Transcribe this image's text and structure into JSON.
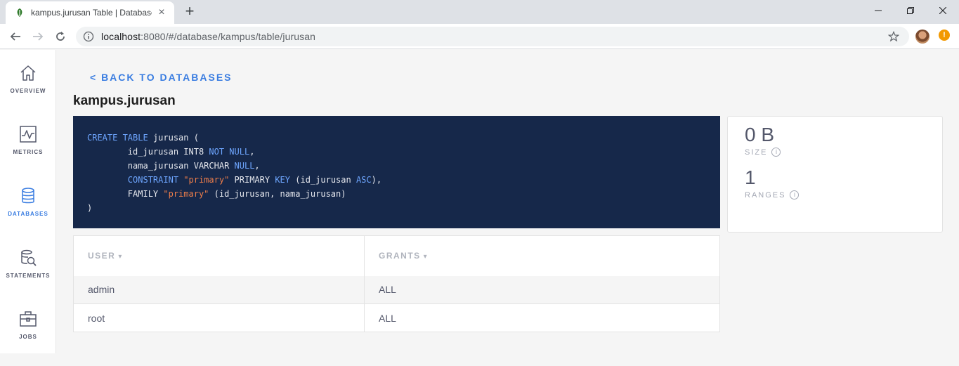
{
  "browser": {
    "tab_title": "kampus.jurusan Table | Databases",
    "tab_close": "×",
    "new_tab": "+",
    "url_host": "localhost",
    "url_rest": ":8080/#/database/kampus/table/jurusan",
    "alert_badge": "!"
  },
  "sidebar": {
    "items": [
      {
        "label": "OVERVIEW",
        "icon": "home-icon"
      },
      {
        "label": "METRICS",
        "icon": "chart-icon"
      },
      {
        "label": "DATABASES",
        "icon": "database-icon",
        "active": true
      },
      {
        "label": "STATEMENTS",
        "icon": "statements-icon"
      },
      {
        "label": "JOBS",
        "icon": "briefcase-icon"
      }
    ]
  },
  "main": {
    "back_link": "< BACK TO DATABASES",
    "title": "kampus.jurusan",
    "create_statement": {
      "line1_kw": "CREATE TABLE",
      "line1_rest": " jurusan (",
      "line2_a": "        id_jurusan INT8 ",
      "line2_kw": "NOT NULL",
      "line2_b": ",",
      "line3_a": "        nama_jurusan VARCHAR ",
      "line3_kw": "NULL",
      "line3_b": ",",
      "line4_kw1": "        CONSTRAINT",
      "line4_str": " \"primary\"",
      "line4_a": " PRIMARY ",
      "line4_kw2": "KEY",
      "line4_b": " (id_jurusan ",
      "line4_kw3": "ASC",
      "line4_c": "),",
      "line5_a": "        FAMILY ",
      "line5_str": "\"primary\"",
      "line5_b": " (id_jurusan, nama_jurusan)",
      "line6": ")"
    },
    "stats": {
      "size_value": "0 B",
      "size_label": "SIZE",
      "ranges_value": "1",
      "ranges_label": "RANGES",
      "info_glyph": "i"
    },
    "grants_table": {
      "columns": [
        "USER",
        "GRANTS"
      ],
      "sort_glyph": "▾",
      "rows": [
        {
          "user": "admin",
          "grants": "ALL"
        },
        {
          "user": "root",
          "grants": "ALL"
        }
      ]
    }
  },
  "colors": {
    "accent": "#3a7de1",
    "code_bg": "#16284a",
    "code_keyword": "#6ea6ff",
    "code_string": "#ec7d4a"
  }
}
